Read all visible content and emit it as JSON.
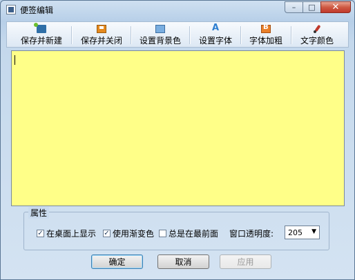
{
  "window": {
    "title": "便签编辑",
    "controls": {
      "minimize": "–",
      "maximize": "□",
      "close": "✕"
    }
  },
  "toolbar": {
    "items": [
      {
        "label": "保存并新建",
        "icon": "save-new-icon"
      },
      {
        "label": "保存并关闭",
        "icon": "save-close-icon"
      },
      {
        "label": "设置背景色",
        "icon": "background-color-icon"
      },
      {
        "label": "设置字体",
        "icon": "font-icon"
      },
      {
        "label": "字体加粗",
        "icon": "bold-icon"
      },
      {
        "label": "文字颜色",
        "icon": "text-color-icon"
      }
    ]
  },
  "editor": {
    "content": "",
    "background": "#ffff88"
  },
  "properties": {
    "legend": "属性",
    "options": [
      {
        "label": "在桌面上显示",
        "checked": true
      },
      {
        "label": "使用渐变色",
        "checked": true
      },
      {
        "label": "总是在最前面",
        "checked": false
      }
    ],
    "transparency": {
      "label": "窗口透明度:",
      "value": "205",
      "arrow": "▼"
    }
  },
  "buttons": {
    "ok": "确定",
    "cancel": "取消",
    "apply": "应用"
  },
  "checkmark": "✓"
}
